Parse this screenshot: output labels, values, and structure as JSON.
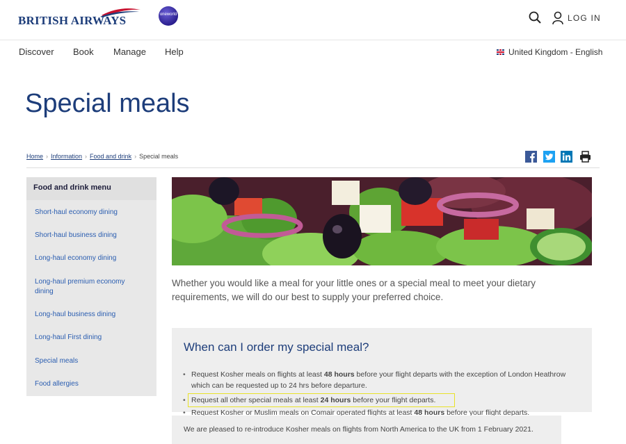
{
  "header": {
    "brand": "BRITISH AIRWAYS",
    "alliance": "oneworld",
    "login_label": "LOG IN"
  },
  "nav": {
    "items": [
      "Discover",
      "Book",
      "Manage",
      "Help"
    ],
    "locale": "United Kingdom - English"
  },
  "page": {
    "title": "Special meals"
  },
  "breadcrumb": {
    "links": [
      "Home",
      "Information",
      "Food and drink"
    ],
    "current": "Special meals"
  },
  "share_icons": [
    "facebook-icon",
    "twitter-icon",
    "linkedin-icon",
    "print-icon"
  ],
  "sidebar": {
    "heading": "Food and drink menu",
    "items": [
      "Short-haul economy dining",
      "Short-haul business dining",
      "Long-haul economy dining",
      "Long-haul premium economy dining",
      "Long-haul business dining",
      "Long-haul First dining",
      "Special meals",
      "Food allergies"
    ]
  },
  "intro": "Whether you would like a meal for your little ones or a special meal to meet your dietary requirements, we will do our best to supply your preferred choice.",
  "info": {
    "title": "When can I order my special meal?",
    "bullets": [
      {
        "pre": "Request Kosher meals on flights at least ",
        "bold": "48 hours",
        "post": " before your flight departs with the exception of London Heathrow which can be requested up to 24 hrs before departure."
      },
      {
        "pre": "Request all other special meals at least ",
        "bold": "24 hours",
        "post": " before your flight departs."
      },
      {
        "pre": "Request Kosher or Muslim meals on Comair operated flights at least ",
        "bold": "48 hours",
        "post": " before your flight departs."
      }
    ],
    "footnote": "We are pleased to re-introduce Kosher meals on flights from North America to the UK from 1 February 2021."
  },
  "colors": {
    "brand_navy": "#1d3d7a",
    "link_blue": "#2a5db0",
    "highlight": "#e8e227"
  }
}
